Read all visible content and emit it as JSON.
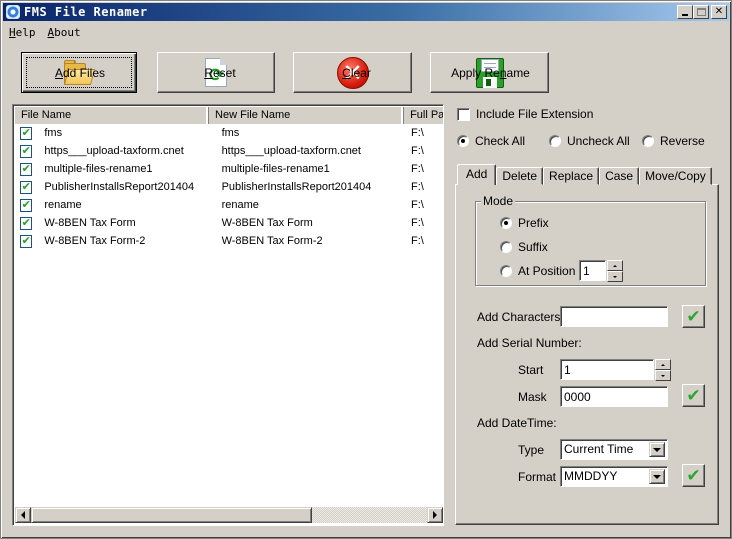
{
  "window": {
    "title": "FMS File Renamer",
    "minimize_glyph": "",
    "close_glyph": "✕"
  },
  "menu": [
    {
      "accel": "H",
      "rest": "elp"
    },
    {
      "accel": "A",
      "rest": "bout"
    }
  ],
  "toolbar": {
    "add_files": {
      "accel": "A",
      "rest": "dd Files"
    },
    "reset": {
      "accel": "R",
      "rest": "eset"
    },
    "clear": {
      "accel": "C",
      "rest": "lear"
    },
    "apply_rename": {
      "pre": "Apply Re",
      "accel": "n",
      "rest": "ame"
    },
    "reset_icon_glyph": "⟳",
    "clear_icon_glyph": "✕"
  },
  "list": {
    "columns": [
      "File Name",
      "New File Name",
      "Full Path"
    ],
    "check_glyph": "✔",
    "rows": [
      {
        "checked": true,
        "file_name": "fms",
        "new_name": "fms",
        "path": "F:\\"
      },
      {
        "checked": true,
        "file_name": "https___upload-taxform.cnet",
        "new_name": "https___upload-taxform.cnet",
        "path": "F:\\"
      },
      {
        "checked": true,
        "file_name": "multiple-files-rename1",
        "new_name": "multiple-files-rename1",
        "path": "F:\\"
      },
      {
        "checked": true,
        "file_name": "PublisherInstallsReport201404",
        "new_name": "PublisherInstallsReport201404",
        "path": "F:\\"
      },
      {
        "checked": true,
        "file_name": "rename",
        "new_name": "rename",
        "path": "F:\\"
      },
      {
        "checked": true,
        "file_name": "W-8BEN Tax Form",
        "new_name": "W-8BEN Tax Form",
        "path": "F:\\"
      },
      {
        "checked": true,
        "file_name": "W-8BEN Tax Form-2",
        "new_name": "W-8BEN Tax Form-2",
        "path": "F:\\"
      }
    ],
    "hscroll_thumb_fraction": 0.71
  },
  "options": {
    "include_extension": {
      "label": "Include File Extension",
      "checked": false
    },
    "selection_radios": [
      {
        "label": "Check All",
        "selected": true
      },
      {
        "label": "Uncheck All",
        "selected": false
      },
      {
        "label": "Reverse",
        "selected": false
      }
    ]
  },
  "tabs": [
    {
      "label": "Add",
      "active": true
    },
    {
      "label": "Delete",
      "active": false
    },
    {
      "label": "Replace",
      "active": false
    },
    {
      "label": "Case",
      "active": false
    },
    {
      "label": "Move/Copy",
      "active": false
    }
  ],
  "add_tab": {
    "mode": {
      "title": "Mode",
      "options": [
        {
          "label": "Prefix",
          "selected": true
        },
        {
          "label": "Suffix",
          "selected": false
        },
        {
          "label": "At Position",
          "selected": false
        }
      ],
      "position_value": "1"
    },
    "add_characters": {
      "label": "Add Characters:",
      "value": ""
    },
    "serial": {
      "label": "Add Serial Number:",
      "start_label": "Start",
      "start_value": "1",
      "mask_label": "Mask",
      "mask_value": "0000"
    },
    "datetime": {
      "label": "Add DateTime:",
      "type_label": "Type",
      "type_value": "Current Time",
      "format_label": "Format",
      "format_value": "MMDDYY"
    },
    "apply_glyph": "✔"
  }
}
